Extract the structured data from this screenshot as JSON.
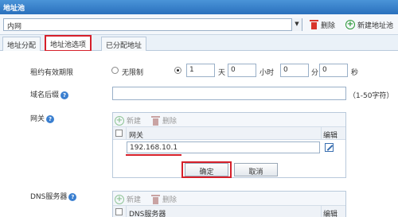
{
  "window": {
    "title": "地址池"
  },
  "toolbar": {
    "pool_value": "内网",
    "delete_label": "删除",
    "new_pool_label": "新建地址池"
  },
  "tabs": [
    {
      "label": "地址分配"
    },
    {
      "label": "地址池选项"
    },
    {
      "label": "已分配地址"
    }
  ],
  "lease": {
    "label": "租约有效期限",
    "unlimited_label": "无限制",
    "days": "1",
    "days_unit": "天",
    "hours": "0",
    "hours_unit": "小时",
    "minutes": "0",
    "minutes_unit": "分",
    "seconds": "0",
    "seconds_unit": "秒"
  },
  "domain_suffix": {
    "label": "域名后缀",
    "value": "",
    "hint": "（1-50字符）"
  },
  "gateway": {
    "label": "网关",
    "new_label": "新建",
    "delete_label": "删除",
    "column_header": "网关",
    "edit_header": "编辑",
    "row_value": "192.168.10.1",
    "confirm_label": "确定",
    "cancel_label": "取消"
  },
  "dns": {
    "label": "DNS服务器",
    "new_label": "新建",
    "delete_label": "删除",
    "column_header": "DNS服务器",
    "edit_header": "编辑"
  },
  "help_glyph": "?",
  "colors": {
    "highlight": "#d6202a",
    "title_bar": "#2a70bd"
  }
}
